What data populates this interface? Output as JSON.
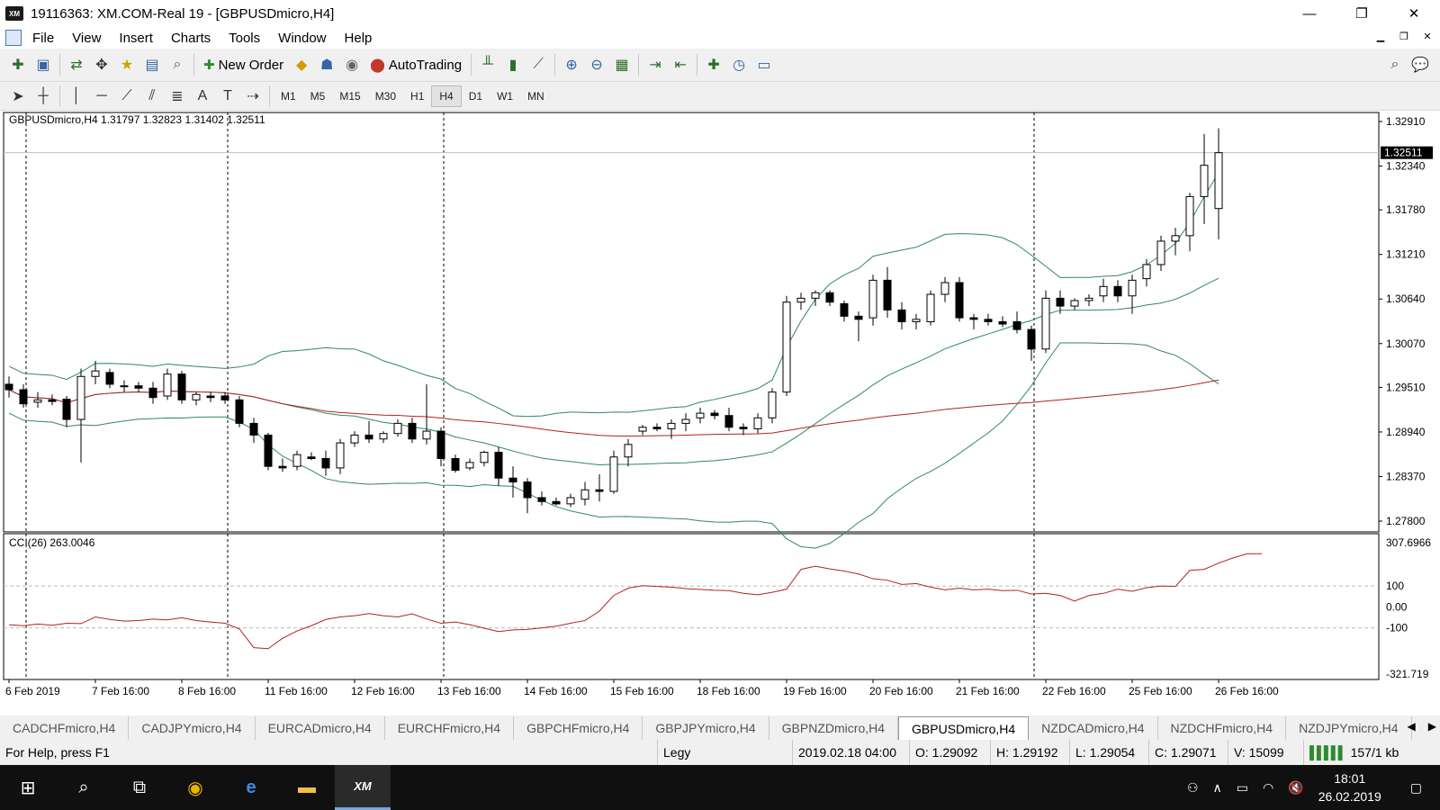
{
  "window": {
    "title": "19116363: XM.COM-Real 19 - [GBPUSDmicro,H4]",
    "icon_label": "XM",
    "min": "—",
    "max": "❐",
    "close": "✕"
  },
  "menu": [
    "File",
    "View",
    "Insert",
    "Charts",
    "Tools",
    "Window",
    "Help"
  ],
  "toolbar": {
    "new_order": "New Order",
    "autotrading": "AutoTrading"
  },
  "timeframes": [
    "M1",
    "M5",
    "M15",
    "M30",
    "H1",
    "H4",
    "D1",
    "W1",
    "MN"
  ],
  "active_timeframe": "H4",
  "chart": {
    "symbol_line": "GBPUSDmicro,H4  1.31797 1.32823 1.31402 1.32511",
    "current_price": "1.32511",
    "price_ticks": [
      "1.32910",
      "1.32340",
      "1.31780",
      "1.31210",
      "1.30640",
      "1.30070",
      "1.29510",
      "1.28940",
      "1.28370",
      "1.27800"
    ],
    "cci_label": "CCI(26) 263.0046",
    "cci_ticks": [
      "307.6966",
      "100",
      "0.00",
      "-100",
      "-321.719"
    ],
    "date_ticks": [
      "6 Feb 2019",
      "7 Feb 16:00",
      "8 Feb 16:00",
      "11 Feb 16:00",
      "12 Feb 16:00",
      "13 Feb 16:00",
      "14 Feb 16:00",
      "15 Feb 16:00",
      "18 Feb 16:00",
      "19 Feb 16:00",
      "20 Feb 16:00",
      "21 Feb 16:00",
      "22 Feb 16:00",
      "25 Feb 16:00",
      "26 Feb 16:00"
    ],
    "colors": {
      "bands": "#2e8b57",
      "ma": "#b22222",
      "cci": "#b22222",
      "bull": "#ffffff",
      "bear": "#000000"
    }
  },
  "chart_data": {
    "type": "candlestick",
    "symbol": "GBPUSDmicro",
    "timeframe": "H4",
    "ylim": [
      1.278,
      1.3291
    ],
    "candles": [
      [
        1.2955,
        1.2965,
        1.2938,
        1.2948
      ],
      [
        1.2948,
        1.2955,
        1.2925,
        1.293
      ],
      [
        1.2932,
        1.2945,
        1.2925,
        1.2935
      ],
      [
        1.2935,
        1.2942,
        1.2928,
        1.2933
      ],
      [
        1.2936,
        1.294,
        1.29,
        1.291
      ],
      [
        1.291,
        1.2975,
        1.2855,
        1.2965
      ],
      [
        1.2965,
        1.2985,
        1.2955,
        1.2972
      ],
      [
        1.297,
        1.2975,
        1.295,
        1.2955
      ],
      [
        1.2952,
        1.296,
        1.2945,
        1.2953
      ],
      [
        1.2953,
        1.2958,
        1.2945,
        1.295
      ],
      [
        1.295,
        1.2958,
        1.293,
        1.2938
      ],
      [
        1.294,
        1.2975,
        1.2935,
        1.2968
      ],
      [
        1.2968,
        1.2972,
        1.293,
        1.2935
      ],
      [
        1.2935,
        1.2945,
        1.2928,
        1.2942
      ],
      [
        1.294,
        1.2945,
        1.2932,
        1.2938
      ],
      [
        1.294,
        1.2945,
        1.293,
        1.2935
      ],
      [
        1.2935,
        1.294,
        1.29,
        1.2905
      ],
      [
        1.2905,
        1.2912,
        1.288,
        1.289
      ],
      [
        1.289,
        1.2893,
        1.2845,
        1.285
      ],
      [
        1.285,
        1.286,
        1.2843,
        1.2848
      ],
      [
        1.285,
        1.287,
        1.2845,
        1.2865
      ],
      [
        1.2862,
        1.2868,
        1.2858,
        1.286
      ],
      [
        1.286,
        1.287,
        1.2838,
        1.2848
      ],
      [
        1.2848,
        1.2885,
        1.284,
        1.288
      ],
      [
        1.288,
        1.2895,
        1.2875,
        1.289
      ],
      [
        1.289,
        1.2908,
        1.288,
        1.2885
      ],
      [
        1.2885,
        1.2895,
        1.288,
        1.2892
      ],
      [
        1.2892,
        1.291,
        1.2888,
        1.2905
      ],
      [
        1.2905,
        1.2912,
        1.288,
        1.2885
      ],
      [
        1.2885,
        1.2955,
        1.2878,
        1.2895
      ],
      [
        1.2895,
        1.29,
        1.285,
        1.286
      ],
      [
        1.286,
        1.2865,
        1.2842,
        1.2845
      ],
      [
        1.2848,
        1.286,
        1.2845,
        1.2855
      ],
      [
        1.2855,
        1.287,
        1.285,
        1.2868
      ],
      [
        1.2868,
        1.2875,
        1.2825,
        1.2835
      ],
      [
        1.2835,
        1.285,
        1.281,
        1.283
      ],
      [
        1.283,
        1.2835,
        1.279,
        1.281
      ],
      [
        1.281,
        1.2818,
        1.28,
        1.2805
      ],
      [
        1.2805,
        1.281,
        1.28,
        1.2802
      ],
      [
        1.2802,
        1.2815,
        1.2798,
        1.281
      ],
      [
        1.2808,
        1.283,
        1.28,
        1.282
      ],
      [
        1.282,
        1.284,
        1.2805,
        1.2818
      ],
      [
        1.2818,
        1.287,
        1.2815,
        1.2862
      ],
      [
        1.2862,
        1.2885,
        1.285,
        1.2878
      ],
      [
        1.2895,
        1.2903,
        1.289,
        1.29
      ],
      [
        1.29,
        1.2905,
        1.2895,
        1.2898
      ],
      [
        1.2898,
        1.291,
        1.2885,
        1.2905
      ],
      [
        1.2905,
        1.2918,
        1.2895,
        1.291
      ],
      [
        1.2912,
        1.2925,
        1.2905,
        1.2918
      ],
      [
        1.2918,
        1.2922,
        1.291,
        1.2915
      ],
      [
        1.2915,
        1.2925,
        1.2895,
        1.29
      ],
      [
        1.29,
        1.2905,
        1.289,
        1.2898
      ],
      [
        1.2898,
        1.2918,
        1.2892,
        1.2912
      ],
      [
        1.2912,
        1.295,
        1.2905,
        1.2945
      ],
      [
        1.2945,
        1.3068,
        1.294,
        1.306
      ],
      [
        1.306,
        1.3072,
        1.305,
        1.3065
      ],
      [
        1.3065,
        1.3075,
        1.3055,
        1.3072
      ],
      [
        1.3072,
        1.3075,
        1.3055,
        1.306
      ],
      [
        1.3058,
        1.3062,
        1.3035,
        1.3042
      ],
      [
        1.3042,
        1.3048,
        1.301,
        1.3038
      ],
      [
        1.304,
        1.3095,
        1.303,
        1.3088
      ],
      [
        1.3088,
        1.3105,
        1.304,
        1.305
      ],
      [
        1.305,
        1.306,
        1.3025,
        1.3035
      ],
      [
        1.3035,
        1.3045,
        1.3025,
        1.3038
      ],
      [
        1.3035,
        1.3075,
        1.303,
        1.307
      ],
      [
        1.307,
        1.3092,
        1.306,
        1.3085
      ],
      [
        1.3085,
        1.3092,
        1.3035,
        1.304
      ],
      [
        1.304,
        1.3045,
        1.3025,
        1.3038
      ],
      [
        1.3038,
        1.3045,
        1.303,
        1.3035
      ],
      [
        1.3035,
        1.3042,
        1.3028,
        1.3032
      ],
      [
        1.3035,
        1.3048,
        1.302,
        1.3025
      ],
      [
        1.3025,
        1.303,
        1.2985,
        1.3
      ],
      [
        1.3,
        1.3075,
        1.2995,
        1.3065
      ],
      [
        1.3065,
        1.3075,
        1.3045,
        1.3055
      ],
      [
        1.3055,
        1.3065,
        1.305,
        1.3062
      ],
      [
        1.3062,
        1.307,
        1.3055,
        1.3065
      ],
      [
        1.3068,
        1.309,
        1.306,
        1.308
      ],
      [
        1.308,
        1.3088,
        1.306,
        1.3068
      ],
      [
        1.3068,
        1.3095,
        1.3045,
        1.3088
      ],
      [
        1.309,
        1.3115,
        1.308,
        1.3108
      ],
      [
        1.3108,
        1.3145,
        1.31,
        1.3138
      ],
      [
        1.3138,
        1.3155,
        1.312,
        1.3145
      ],
      [
        1.3145,
        1.32,
        1.3125,
        1.3195
      ],
      [
        1.3195,
        1.3275,
        1.316,
        1.3235
      ],
      [
        1.31797,
        1.32823,
        1.31402,
        1.32511
      ]
    ],
    "cci": [
      -85,
      -90,
      -82,
      -88,
      -78,
      -80,
      -48,
      -60,
      -68,
      -65,
      -58,
      -62,
      -52,
      -65,
      -72,
      -78,
      -105,
      -195,
      -200,
      -150,
      -115,
      -90,
      -60,
      -48,
      -42,
      -32,
      -42,
      -48,
      -33,
      -58,
      -78,
      -72,
      -85,
      -102,
      -118,
      -110,
      -108,
      -100,
      -92,
      -78,
      -65,
      -20,
      55,
      90,
      102,
      98,
      95,
      88,
      84,
      80,
      78,
      65,
      58,
      70,
      85,
      180,
      195,
      182,
      172,
      158,
      135,
      128,
      108,
      112,
      95,
      82,
      90,
      82,
      85,
      78,
      80,
      62,
      65,
      55,
      28,
      55,
      65,
      85,
      75,
      92,
      100,
      98,
      175,
      180,
      210,
      235,
      255,
      255
    ]
  }
}
